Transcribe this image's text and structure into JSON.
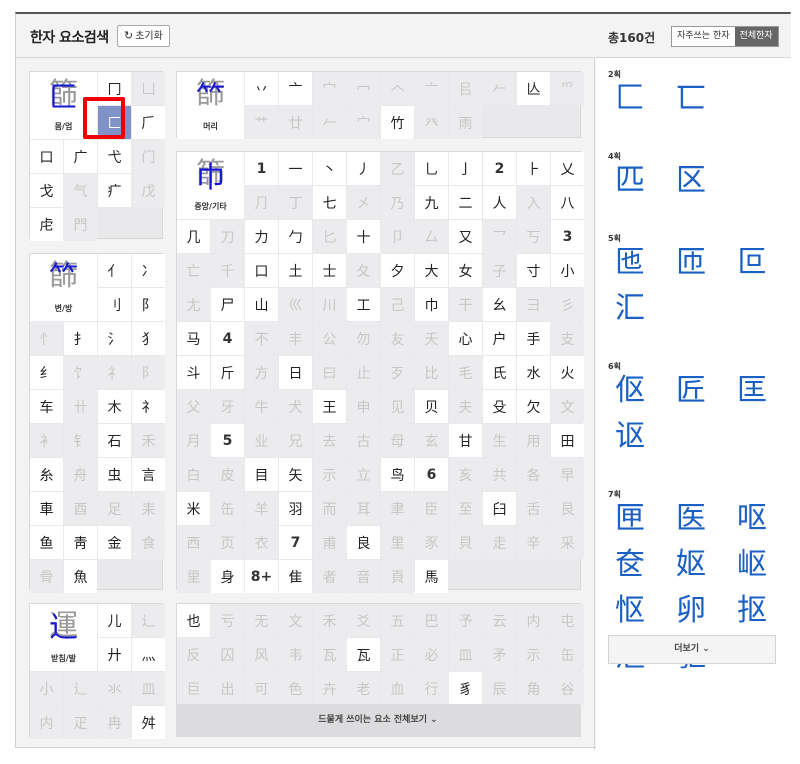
{
  "header": {
    "title": "한자 요소검색",
    "reset_label": "초기화",
    "reset_icon": "refresh-icon"
  },
  "box_enclosure": {
    "label": "몸/엄",
    "sample": {
      "gray": "篩",
      "blue": "匚"
    },
    "cells": [
      "冂",
      "凵",
      "匚",
      "𠂆",
      "口",
      "广",
      "弋",
      "门",
      "戈",
      "气",
      "疒",
      "戊",
      "虍",
      "門"
    ],
    "selected": "匚"
  },
  "box_top": {
    "label": "머리",
    "sample": {
      "gray": "篩",
      "blue": "⺮"
    },
    "cells": [
      "丷",
      "亠",
      "宀",
      "冖",
      "𠆢",
      "亠",
      "㠯",
      "𠂉",
      "亾",
      "爫",
      "艹",
      "廿",
      "𠂉",
      "宀",
      "竹",
      "癶",
      "雨"
    ]
  },
  "box_side": {
    "label": "변/방",
    "sample": {
      "gray": "篩",
      "blue": "⺮"
    },
    "cells": [
      "亻",
      "冫",
      "刂",
      "⻖",
      "忄",
      "扌",
      "氵",
      "犭",
      "纟",
      "饣",
      "礻",
      "阝",
      "车",
      "卄",
      "木",
      "礻",
      "衤",
      "钅",
      "石",
      "禾",
      "糸",
      "舟",
      "虫",
      "言",
      "車",
      "酉",
      "足",
      "耒",
      "鱼",
      "靑",
      "金",
      "食",
      "骨",
      "魚"
    ]
  },
  "box_middle": {
    "label": "중앙/기타",
    "sample": {
      "gray": "篩",
      "blue": "巾"
    },
    "cells": [
      "1",
      "一",
      "丶",
      "丿",
      "乙",
      "乚",
      "亅",
      "2",
      "⺊",
      "乂",
      "⺆",
      "丁",
      "七",
      "㐅",
      "乃",
      "九",
      "二",
      "人",
      "入",
      "八",
      "几",
      "刀",
      "力",
      "勹",
      "匕",
      "十",
      "卩",
      "厶",
      "又",
      "乛",
      "丂",
      "3",
      "亡",
      "千",
      "口",
      "土",
      "士",
      "夂",
      "夕",
      "大",
      "女",
      "子",
      "寸",
      "小",
      "尢",
      "尸",
      "山",
      "巛",
      "川",
      "工",
      "己",
      "巾",
      "干",
      "幺",
      "彐",
      "彡",
      "马",
      "4",
      "不",
      "丰",
      "公",
      "勿",
      "友",
      "夭",
      "心",
      "户",
      "手",
      "支",
      "斗",
      "斤",
      "方",
      "日",
      "曰",
      "止",
      "歹",
      "比",
      "毛",
      "氏",
      "水",
      "火",
      "父",
      "牙",
      "牛",
      "犬",
      "王",
      "申",
      "见",
      "贝",
      "夫",
      "殳",
      "欠",
      "文",
      "月",
      "5",
      "业",
      "兄",
      "去",
      "古",
      "母",
      "玄",
      "甘",
      "生",
      "用",
      "田",
      "白",
      "皮",
      "目",
      "矢",
      "示",
      "立",
      "鸟",
      "6",
      "亥",
      "共",
      "各",
      "早",
      "米",
      "缶",
      "羊",
      "羽",
      "而",
      "耳",
      "聿",
      "臣",
      "至",
      "臼",
      "舌",
      "艮",
      "西",
      "页",
      "衣",
      "7",
      "甫",
      "良",
      "里",
      "豕",
      "貝",
      "走",
      "辛",
      "采",
      "里",
      "身",
      "8+",
      "隹",
      "者",
      "音",
      "頁",
      "馬"
    ]
  },
  "box_bottom": {
    "label": "받침/발",
    "sample": {
      "gray": "運",
      "blue": "辶"
    },
    "cells": [
      "儿",
      "辶",
      "廾",
      "灬",
      "小",
      "辶",
      "氺",
      "皿",
      "内",
      "疋",
      "冉",
      "舛"
    ]
  },
  "box_other": {
    "cells": [
      "也",
      "亏",
      "无",
      "文",
      "禾",
      "爻",
      "五",
      "巴",
      "予",
      "云",
      "内",
      "屯",
      "反",
      "囚",
      "风",
      "韦",
      "瓦",
      "瓦",
      "正",
      "必",
      "皿",
      "矛",
      "示",
      "缶",
      "巨",
      "出",
      "可",
      "色",
      "卉",
      "老",
      "血",
      "行",
      "豸",
      "辰",
      "角",
      "谷"
    ],
    "more_label": "드물게 쓰이는 요소 전체보기"
  },
  "results": {
    "total": "총160건",
    "tabs": [
      "자주쓰는 한자",
      "전체한자"
    ],
    "active_tab": "전체한자",
    "sections": [
      {
        "stroke": "2획",
        "chars": [
          "匚",
          "匸"
        ]
      },
      {
        "stroke": "4획",
        "chars": [
          "匹",
          "区"
        ]
      },
      {
        "stroke": "5획",
        "chars": [
          "匜",
          "匝",
          "叵",
          "汇"
        ]
      },
      {
        "stroke": "6획",
        "chars": [
          "伛",
          "匠",
          "匡",
          "讴"
        ]
      },
      {
        "stroke": "7획",
        "chars": [
          "匣",
          "医",
          "呕",
          "奁",
          "妪",
          "岖",
          "怄",
          "卵",
          "抠",
          "沤",
          "驱"
        ]
      }
    ],
    "more_label": "더보기"
  }
}
